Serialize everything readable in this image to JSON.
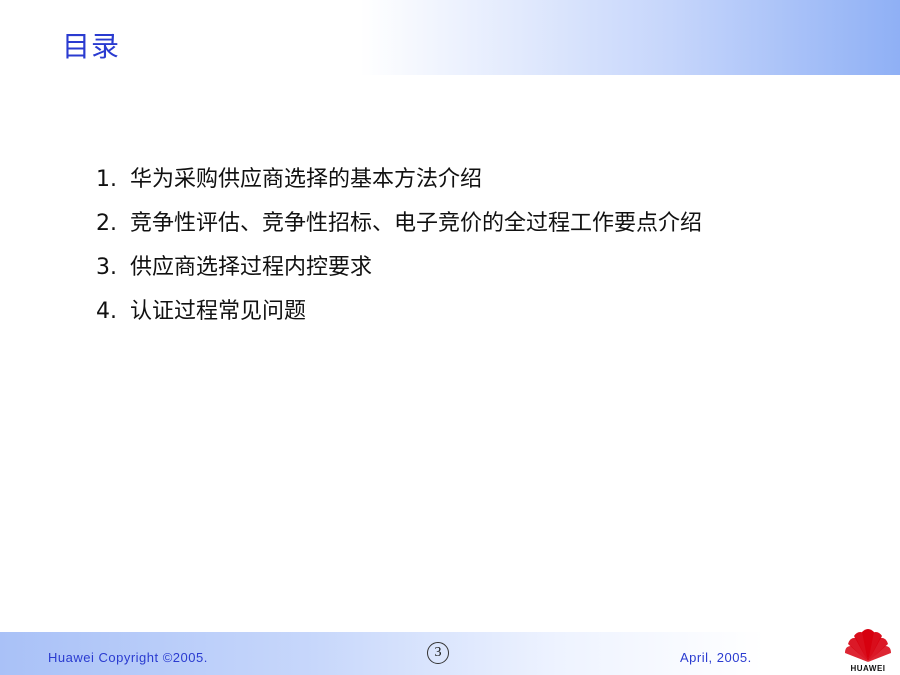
{
  "slide": {
    "title": "目录",
    "agenda": [
      {
        "num": "1.",
        "text": "华为采购供应商选择的基本方法介绍"
      },
      {
        "num": "2.",
        "text": "竞争性评估、竞争性招标、电子竞价的全过程工作要点介绍"
      },
      {
        "num": "3.",
        "text": "供应商选择过程内控要求"
      },
      {
        "num": "4.",
        "text": "认证过程常见问题"
      }
    ]
  },
  "footer": {
    "copyright": "Huawei Copyright ©2005.",
    "page_number": "3",
    "date": "April, 2005.",
    "logo_text": "HUAWEI"
  },
  "colors": {
    "title": "#2a3bd0",
    "header_gradient_end": "#8fb0f5",
    "logo_red": "#d7000f"
  }
}
